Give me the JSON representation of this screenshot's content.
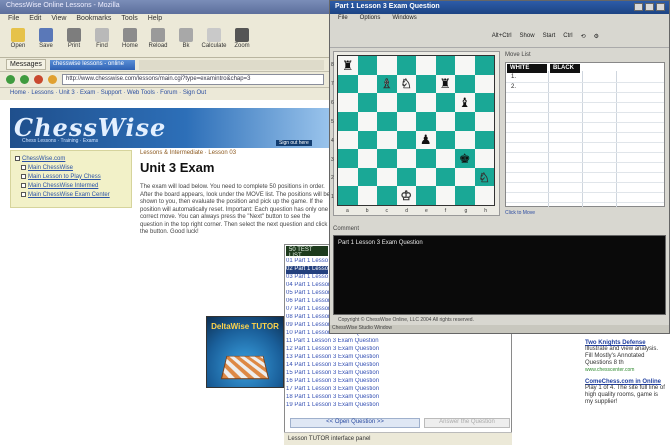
{
  "browser": {
    "title": "ChessWise Online Lessons - Mozilla",
    "menu": [
      "File",
      "Edit",
      "View",
      "Bookmarks",
      "Tools",
      "Help"
    ],
    "toolbar": [
      "Open",
      "Save",
      "Print",
      "Find",
      "Home",
      "Reload",
      "Bk",
      "Calculate",
      "Zoom"
    ],
    "message_label": "Messages",
    "message_tab": "chesswise lessons - online",
    "address": "http://www.chesswise.com/lessons/main.cgi?type=examintro&chap=3",
    "links": "Home  ·  Lessons  ·  Unit 3  ·  Exam  ·  Support  ·  Web Tools  ·  Forum  ·  Sign Out"
  },
  "banner": {
    "logo": "ChessWise",
    "tagline": "Chess Lessons · Training · Exams",
    "link": "Sign out here"
  },
  "leftnav": {
    "items": [
      {
        "label": "ChessWise.com",
        "indent": false
      },
      {
        "label": "Main ChessWise",
        "indent": true
      },
      {
        "label": "Main Lesson to Play Chess",
        "indent": true
      },
      {
        "label": "Main ChessWise Intermed",
        "indent": true
      },
      {
        "label": "Main ChessWise Exam Center",
        "indent": true
      }
    ]
  },
  "content": {
    "breadcrumb": "Lessons & Intermediate  ·  Lesson 03",
    "title": "Unit 3 Exam",
    "body": "The exam will load below. You need to complete 50 positions in order. After the board appears, look under the MOVE list. The positions will be shown to you, then evaluate the position and pick up the game. If the position will automatically reset. Important: Each question has only one correct move. You can always press the \"Next\" button to see the question in the top right corner. Then select the next question and click the button. Good luck!",
    "ad_title": "DeltaWise TUTOR"
  },
  "right_ads": [
    {
      "title": "Two Knights Defense",
      "text": "Illustrate and view analysis. Fill Mostly's Annotated Questions 8 th",
      "url": "www.chesscenter.com"
    },
    {
      "title": "ComeChess.com in Online",
      "text": "Play 1 of 4. The site full line of high quality rooms, game is my supplier!",
      "url": ""
    }
  ],
  "questions": {
    "header": "50 TEST LIST",
    "items": [
      "01 Part 1 Lesson 3 Exam Question",
      "02 Part 1 Lesson 3 Exam Question",
      "03 Part 1 Lesson 3 Exam Question",
      "04 Part 1 Lesson 3 Exam Question",
      "05 Part 1 Lesson 3 Exam Question",
      "06 Part 1 Lesson 3 Exam Question",
      "07 Part 1 Lesson 3 Exam Question",
      "08 Part 1 Lesson 3 Exam Question",
      "09 Part 1 Lesson 3 Exam Question",
      "10 Part 1 Lesson 3 Exam Question",
      "11 Part 1 Lesson 3 Exam Question",
      "12 Part 1 Lesson 3 Exam Question",
      "13 Part 1 Lesson 3 Exam Question",
      "14 Part 1 Lesson 3 Exam Question",
      "15 Part 1 Lesson 3 Exam Question",
      "16 Part 1 Lesson 3 Exam Question",
      "17 Part 1 Lesson 3 Exam Question",
      "18 Part 1 Lesson 3 Exam Question",
      "19 Part 1 Lesson 3 Exam Question"
    ],
    "selected_index": 1,
    "prev_label": "<< Open Question >>",
    "next_label": "Answer the Question",
    "status": "Lesson TUTOR interface panel"
  },
  "chess": {
    "title": "Part 1 Lesson 3 Exam Question",
    "menu": [
      "File",
      "Options",
      "Windows"
    ],
    "toolbar": [
      "Alt+Ctrl",
      "Show",
      "Start",
      "Ctrl"
    ],
    "moves_label": "Move List",
    "white_header": "WHITE",
    "black_header": "BLACK",
    "move_numbers": [
      "1.",
      "2."
    ],
    "moves_footer": "Click to Move",
    "comment_label": "Comment",
    "comment_text": "Part 1 Lesson 3 Exam Question",
    "status": "Copyright © ChessWise Online, LLC 2004 All rights reserved.",
    "bottom": "ChessWise Studio Window",
    "ranks": [
      "8",
      "7",
      "6",
      "5",
      "4",
      "3",
      "2",
      "1"
    ],
    "files": [
      "a",
      "b",
      "c",
      "d",
      "e",
      "f",
      "g",
      "h"
    ],
    "pieces": [
      {
        "sq": "a8",
        "glyph": "♜",
        "color": "b"
      },
      {
        "sq": "c7",
        "glyph": "♗",
        "color": "w"
      },
      {
        "sq": "d7",
        "glyph": "♘",
        "color": "w"
      },
      {
        "sq": "f7",
        "glyph": "♜",
        "color": "b"
      },
      {
        "sq": "g6",
        "glyph": "♝",
        "color": "b"
      },
      {
        "sq": "e4",
        "glyph": "♟",
        "color": "b"
      },
      {
        "sq": "g3",
        "glyph": "♚",
        "color": "b"
      },
      {
        "sq": "h2",
        "glyph": "♘",
        "color": "w"
      },
      {
        "sq": "d1",
        "glyph": "♔",
        "color": "w"
      }
    ],
    "light_square": "#f7f7f5",
    "dark_square": "#1aa896"
  }
}
